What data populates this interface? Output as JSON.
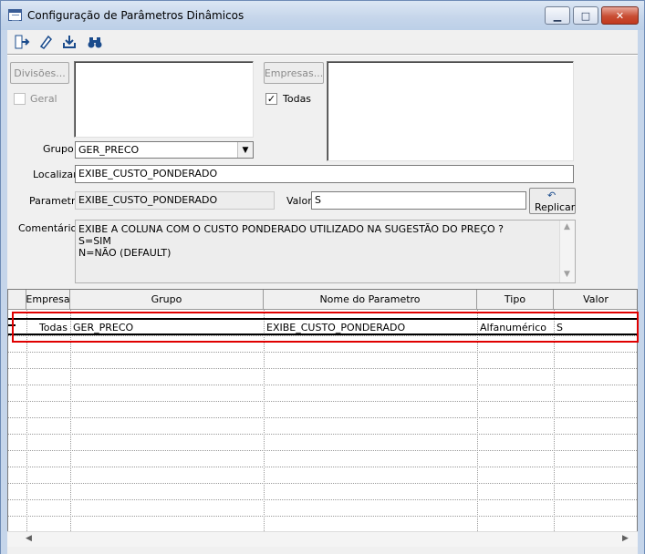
{
  "window": {
    "title": "Configuração de Parâmetros Dinâmicos"
  },
  "toolbar": {
    "icons": [
      "exit-icon",
      "eraser-icon",
      "save-icon",
      "binoculars-icon"
    ]
  },
  "divisoes": {
    "button_label": "Divisões...",
    "geral_label": "Geral",
    "geral_checked": false
  },
  "empresas": {
    "button_label": "Empresas...",
    "todas_label": "Todas",
    "todas_checked": true
  },
  "grupo": {
    "label": "Grupo",
    "value": "GER_PRECO"
  },
  "localizar": {
    "label": "Localizar",
    "value": "EXIBE_CUSTO_PONDERADO"
  },
  "parametro": {
    "label": "Parametro",
    "value": "EXIBE_CUSTO_PONDERADO"
  },
  "valor": {
    "label": "Valor",
    "value": "S"
  },
  "replicar": {
    "label": "Replicar"
  },
  "comentarios": {
    "label": "Comentários",
    "lines": [
      "EXIBE A COLUNA COM O CUSTO PONDERADO UTILIZADO NA SUGESTÃO DO PREÇO ?",
      "S=SIM",
      "N=NÃO (DEFAULT)"
    ]
  },
  "grid": {
    "columns": [
      "Empresa",
      "Grupo",
      "Nome do Parametro",
      "Tipo",
      "Valor"
    ],
    "rows": [
      {
        "empresa": "Todas",
        "grupo": "GER_PRECO",
        "nome": "EXIBE_CUSTO_PONDERADO",
        "tipo": "Alfanumérico",
        "valor": "S"
      }
    ]
  },
  "colors": {
    "highlight": "#e00000",
    "titlebar": "#c5d5ea"
  }
}
